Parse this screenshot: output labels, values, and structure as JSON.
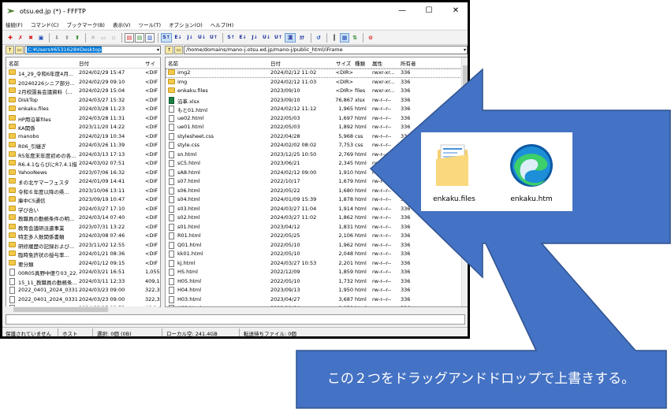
{
  "window": {
    "title": "otsu.ed.jp (*) - FFFTP",
    "controls": {
      "minimize": "—",
      "maximize": "☐",
      "close": "✕"
    }
  },
  "menu": [
    "接続(F)",
    "コマンド(C)",
    "ブックマーク(B)",
    "表示(V)",
    "ツール(T)",
    "オプション(O)",
    "ヘルプ(H)"
  ],
  "toolbar": {
    "mode_labels": [
      "S↑",
      "E↓",
      "J↓",
      "U↓",
      "U↑",
      "S↑",
      "E↓",
      "J↓",
      "U↓",
      "U↑",
      "漢",
      "ｶﾅ"
    ]
  },
  "local": {
    "path": "C:¥Users¥6531628¥Desktop",
    "columns": [
      "名前",
      "日付",
      "サイ"
    ],
    "rows": [
      {
        "name": "14_29_令和6年度4月...",
        "date": "2024/02/29 15:47",
        "size": "<DIF",
        "type": "folder"
      },
      {
        "name": "20240226シニア部分...",
        "date": "2024/02/29 09:10",
        "size": "<DIF",
        "type": "folder"
      },
      {
        "name": "2月校園長会議資料（...",
        "date": "2024/02/29 15:04",
        "size": "<DIF",
        "type": "folder"
      },
      {
        "name": "DiskTop",
        "date": "2024/03/27 15:32",
        "size": "<DIF",
        "type": "folder"
      },
      {
        "name": "enkaku.files",
        "date": "2024/03/28 11:23",
        "size": "<DIF",
        "type": "folder"
      },
      {
        "name": "HP用沿革files",
        "date": "2024/03/28 11:31",
        "size": "<DIF",
        "type": "folder"
      },
      {
        "name": "KA関係",
        "date": "2023/11/20 14:22",
        "size": "<DIF",
        "type": "folder"
      },
      {
        "name": "manobo",
        "date": "2024/02/19 10:34",
        "size": "<DIF",
        "type": "folder"
      },
      {
        "name": "R06_引継ぎ",
        "date": "2024/03/26 11:39",
        "size": "<DIF",
        "type": "folder"
      },
      {
        "name": "R5年度末年度初めの各...",
        "date": "2024/03/13 17:13",
        "size": "<DIF",
        "type": "folder"
      },
      {
        "name": "R6.4.1ならびにR7.4.1措...",
        "date": "2024/03/02 07:51",
        "size": "<DIF",
        "type": "folder"
      },
      {
        "name": "YahooNews",
        "date": "2023/07/06 16:32",
        "size": "<DIF",
        "type": "folder"
      },
      {
        "name": "まの北サマーフェスタ",
        "date": "2024/01/09 14:41",
        "size": "<DIF",
        "type": "folder"
      },
      {
        "name": "令和６年度以降の県...",
        "date": "2023/10/06 13:11",
        "size": "<DIF",
        "type": "folder"
      },
      {
        "name": "庫中CS通信",
        "date": "2023/09/19 10:47",
        "size": "<DIF",
        "type": "folder"
      },
      {
        "name": "学び合い",
        "date": "2024/03/27 17:10",
        "size": "<DIF",
        "type": "folder"
      },
      {
        "name": "教職員の勤務条件の明...",
        "date": "2024/03/14 07:40",
        "size": "<DIF",
        "type": "folder"
      },
      {
        "name": "教育会議研派遣事業",
        "date": "2023/07/31 13:22",
        "size": "<DIF",
        "type": "folder"
      },
      {
        "name": "特定多人数関係書類",
        "date": "2024/03/08 07:46",
        "size": "<DIF",
        "type": "folder"
      },
      {
        "name": "研修履歴の記録および...",
        "date": "2023/11/02 12:55",
        "size": "<DIF",
        "type": "folder"
      },
      {
        "name": "臨時免許状の授与率...",
        "date": "2024/01/21 08:36",
        "size": "<DIF",
        "type": "folder"
      },
      {
        "name": "要分類",
        "date": "2024/01/12 09:15",
        "size": "<DIF",
        "type": "folder"
      },
      {
        "name": "00R05真野中便り03_22...",
        "date": "2024/03/21 16:51",
        "size": "1,055,9",
        "type": "file"
      },
      {
        "name": "15_11_教職員の勤務条...",
        "date": "2024/03/11 12:33",
        "size": "409,1",
        "type": "file"
      },
      {
        "name": "2022_0401_2024_0331...",
        "date": "2024/03/23 09:00",
        "size": "322,3",
        "type": "file"
      },
      {
        "name": "2022_0401_2024_0331...",
        "date": "2024/03/23 09:00",
        "size": "322,3",
        "type": "file"
      },
      {
        "name": "2023_事業休業中勤務...",
        "date": "2024/03/15 08:53",
        "size": "46,0",
        "type": "file"
      }
    ]
  },
  "remote": {
    "path": "/home/domains/mano-j.otsu.ed.jp/mano-j/public_html/iFrame",
    "columns": [
      "名前",
      "日付",
      "サイズ",
      "種類",
      "属性",
      "所有者"
    ],
    "rows": [
      {
        "name": "img2",
        "date": "2024/02/12 11:02",
        "size": "<DIR>",
        "kind": "",
        "attr": "rwxr-xr...",
        "owner": "336",
        "type": "folder"
      },
      {
        "name": "img",
        "date": "2024/02/12 11:03",
        "size": "<DIR>",
        "kind": "",
        "attr": "rwxr-xr...",
        "owner": "336",
        "type": "folder"
      },
      {
        "name": "enkaku.files",
        "date": "2023/09/10",
        "size": "<DIR>",
        "kind": "files",
        "attr": "rwxr-xr...",
        "owner": "336",
        "type": "folder"
      },
      {
        "name": "沿革.xlsx",
        "date": "2023/09/10",
        "size": "76,867",
        "kind": "xlsx",
        "attr": "rw-r--r--",
        "owner": "336",
        "type": "excel"
      },
      {
        "name": "もと01.html",
        "date": "2024/02/12 11:12",
        "size": "1,965",
        "kind": "html",
        "attr": "rw-r--r--",
        "owner": "336",
        "type": "file"
      },
      {
        "name": "ue02.html",
        "date": "2022/05/03",
        "size": "1,697",
        "kind": "html",
        "attr": "rw-r--r--",
        "owner": "336",
        "type": "file"
      },
      {
        "name": "ue01.html",
        "date": "2022/05/03",
        "size": "1,892",
        "kind": "html",
        "attr": "rw-r--r--",
        "owner": "336",
        "type": "file"
      },
      {
        "name": "stylesheet.css",
        "date": "2022/04/28",
        "size": "5,968",
        "kind": "css",
        "attr": "rw-r--r--",
        "owner": "336",
        "type": "file"
      },
      {
        "name": "style.css",
        "date": "2024/02/02 08:02",
        "size": "7,753",
        "kind": "css",
        "attr": "rw-r--r--",
        "owner": "336",
        "type": "file"
      },
      {
        "name": "sn.html",
        "date": "2023/12/25 10:50",
        "size": "2,769",
        "kind": "html",
        "attr": "rw-r--r--",
        "owner": "336",
        "type": "file"
      },
      {
        "name": "sC5.html",
        "date": "2023/06/21",
        "size": "2,345",
        "kind": "html",
        "attr": "rw-r--r--",
        "owner": "336",
        "type": "file"
      },
      {
        "name": "sA8.html",
        "date": "2024/02/12 09:00",
        "size": "1,910",
        "kind": "html",
        "attr": "rw-r--r--",
        "owner": "336",
        "type": "file"
      },
      {
        "name": "s07.html",
        "date": "2022/10/17",
        "size": "1,679",
        "kind": "html",
        "attr": "rw-r--r--",
        "owner": "336",
        "type": "file"
      },
      {
        "name": "s06.html",
        "date": "2022/05/22",
        "size": "1,680",
        "kind": "html",
        "attr": "rw-r--r--",
        "owner": "336",
        "type": "file"
      },
      {
        "name": "s04.html",
        "date": "2024/01/09 15:39",
        "size": "1,878",
        "kind": "html",
        "attr": "rw-r--r--",
        "owner": "336",
        "type": "file"
      },
      {
        "name": "s03.html",
        "date": "2024/03/27 11:04",
        "size": "1,914",
        "kind": "html",
        "attr": "rw-r--r--",
        "owner": "336",
        "type": "file"
      },
      {
        "name": "s02.html",
        "date": "2024/03/27 11:02",
        "size": "1,862",
        "kind": "html",
        "attr": "rw-r--r--",
        "owner": "336",
        "type": "file"
      },
      {
        "name": "s01.html",
        "date": "2023/04/12",
        "size": "1,831",
        "kind": "html",
        "attr": "rw-r--r--",
        "owner": "336",
        "type": "file"
      },
      {
        "name": "R01.html",
        "date": "2022/05/25",
        "size": "2,106",
        "kind": "html",
        "attr": "rw-r--r--",
        "owner": "336",
        "type": "file"
      },
      {
        "name": "Q01.html",
        "date": "2022/05/10",
        "size": "1,962",
        "kind": "html",
        "attr": "rw-r--r--",
        "owner": "336",
        "type": "file"
      },
      {
        "name": "kk01.html",
        "date": "2022/05/10",
        "size": "2,048",
        "kind": "html",
        "attr": "rw-r--r--",
        "owner": "336",
        "type": "file"
      },
      {
        "name": "kj.html",
        "date": "2024/03/27 10:53",
        "size": "2,201",
        "kind": "html",
        "attr": "rw-r--r--",
        "owner": "336",
        "type": "file"
      },
      {
        "name": "HS.html",
        "date": "2022/12/09",
        "size": "1,859",
        "kind": "html",
        "attr": "rw-r--r--",
        "owner": "336",
        "type": "file"
      },
      {
        "name": "H05.html",
        "date": "2022/05/10",
        "size": "1,732",
        "kind": "html",
        "attr": "rw-r--r--",
        "owner": "336",
        "type": "file"
      },
      {
        "name": "H04.html",
        "date": "2023/09/13",
        "size": "1,950",
        "kind": "html",
        "attr": "rw-r--r--",
        "owner": "336",
        "type": "file"
      },
      {
        "name": "H03.html",
        "date": "2023/04/27",
        "size": "3,687",
        "kind": "html",
        "attr": "rw-r--r--",
        "owner": "336",
        "type": "file"
      },
      {
        "name": "H02.html",
        "date": "2022/11/04",
        "size": "1,850",
        "kind": "html",
        "attr": "rw-r--r--",
        "owner": "336",
        "type": "file"
      }
    ]
  },
  "status": {
    "security": "保護されていません",
    "host": "ホスト",
    "selection": "選択: 0個 (0B)",
    "local_free": "ローカル空: 241.4GB",
    "transfer": "転送待ちファイル: 0個"
  },
  "callout": {
    "text": "この２つをドラッグアンドドロップで上書きする。",
    "color": "#4472c4"
  },
  "file_cards": [
    {
      "label": "enkaku.files",
      "icon": "folder-icon"
    },
    {
      "label": "enkaku.htm",
      "icon": "edge-browser-icon"
    }
  ]
}
